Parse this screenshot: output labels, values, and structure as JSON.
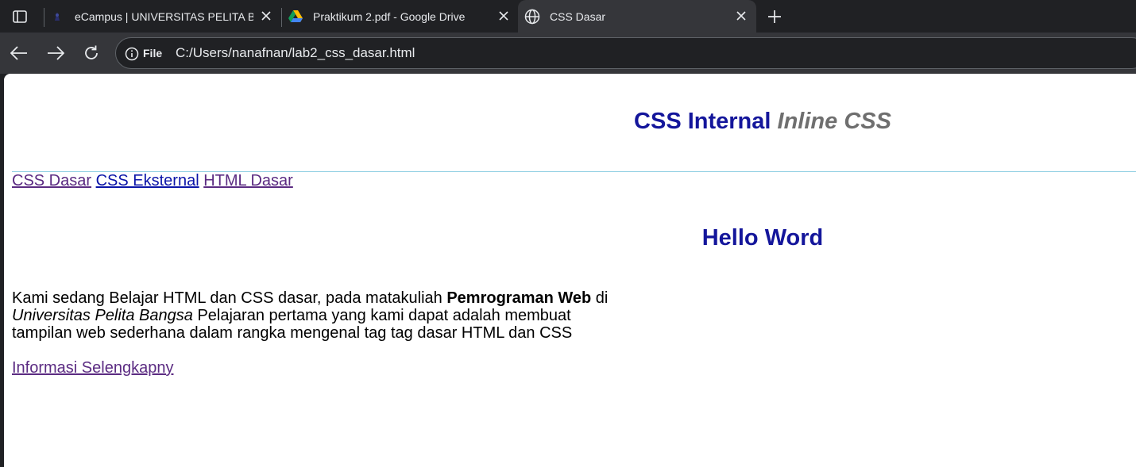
{
  "tabs": [
    {
      "title": "eCampus | UNIVERSITAS PELITA B",
      "favicon": "ecampus-favicon",
      "active": false
    },
    {
      "title": "Praktikum 2.pdf - Google Drive",
      "favicon": "google-drive-icon",
      "active": false
    },
    {
      "title": "CSS Dasar",
      "favicon": "globe-icon",
      "active": true
    }
  ],
  "omnibox": {
    "scheme_label": "File",
    "url": "C:/Users/nanafnan/lab2_css_dasar.html"
  },
  "page": {
    "heading": {
      "part1": "CSS Internal",
      "part2": "Inline CSS",
      "color": "#14169b",
      "italic_color": "#6f6f6f"
    },
    "nav_links": [
      "CSS Dasar",
      "CSS Eksternal",
      "HTML Dasar"
    ],
    "subheading": "Hello Word",
    "paragraph": {
      "t1": "Kami sedang Belajar HTML dan CSS dasar, pada matakuliah ",
      "bold": "Pemrograman Web",
      "t2": " di ",
      "italic": "Universitas Pelita Bangsa",
      "t3": " Pelajaran pertama yang kami dapat adalah membuat tampilan web sederhana dalam rangka mengenal tag tag dasar HTML dan CSS"
    },
    "more_link": "Informasi Selengkapny"
  },
  "colors": {
    "tabstrip": "#202124",
    "toolbar": "#35363a",
    "link_visited": "#5b2b82",
    "link_unvisited": "#0b14a8",
    "hr": "#8fcfe3"
  }
}
